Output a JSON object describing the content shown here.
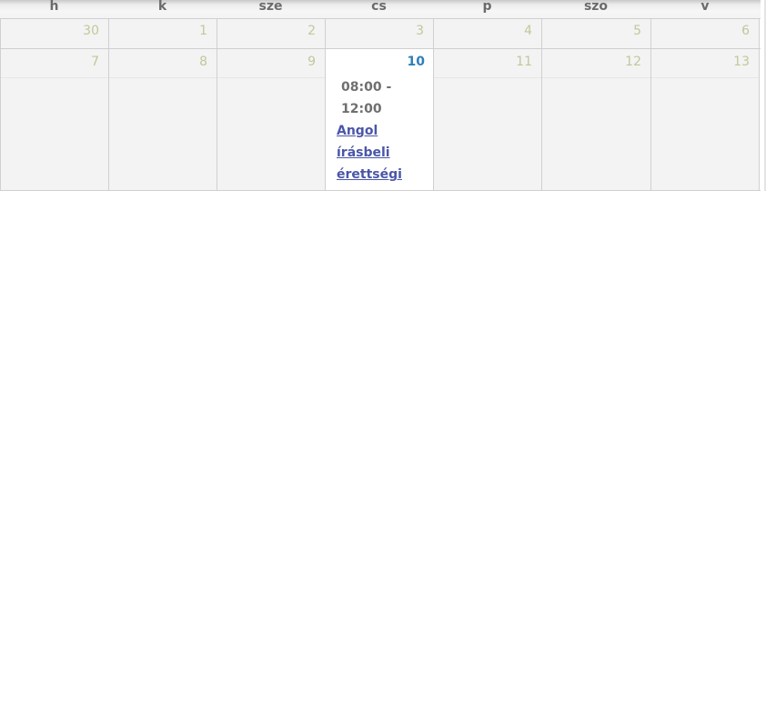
{
  "calendar": {
    "weekdays": [
      "h",
      "k",
      "sze",
      "cs",
      "p",
      "szo",
      "v"
    ],
    "weeks": [
      {
        "days": [
          "30",
          "1",
          "2",
          "3",
          "4",
          "5",
          "6"
        ]
      },
      {
        "days": [
          "7",
          "8",
          "9",
          "10",
          "11",
          "12",
          "13"
        ]
      }
    ],
    "today_index": 3,
    "event": {
      "time_line1": "08:00 -",
      "time_line2": "12:00",
      "title_line1": "Angol",
      "title_line2": "írásbeli",
      "title_line3": "érettségi"
    }
  },
  "colors": {
    "today_number": "#2e7fb8",
    "other_number": "#c2c79a",
    "event_link": "#4a56a8",
    "event_time": "#6f6f6f",
    "cell_bg": "#f3f3f3"
  }
}
